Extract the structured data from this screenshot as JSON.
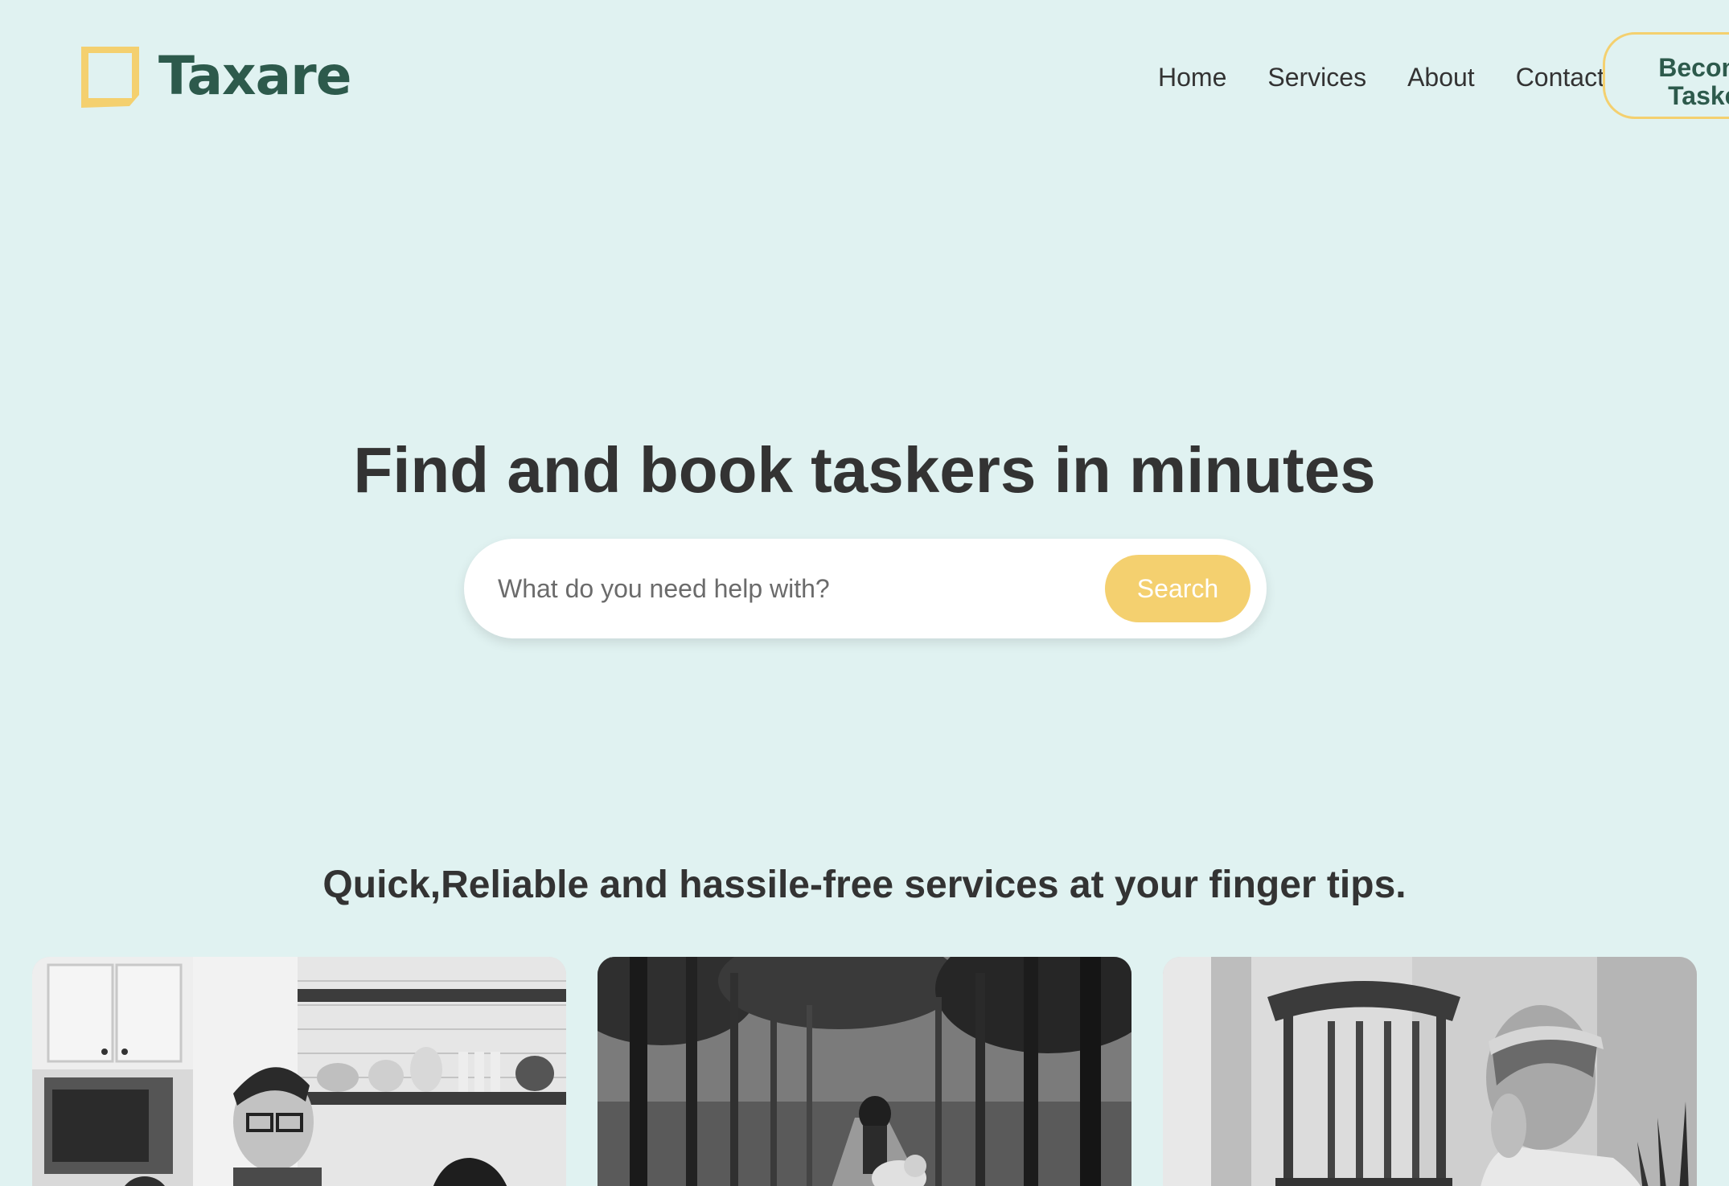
{
  "brand": {
    "name": "Taxare",
    "logo_icon": "square-frame-icon",
    "color_primary": "#2d5a4c",
    "color_accent": "#f4d06f",
    "color_background": "#e0f2f1"
  },
  "nav": {
    "items": [
      {
        "label": "Home"
      },
      {
        "label": "Services"
      },
      {
        "label": "About"
      },
      {
        "label": "Contact"
      }
    ],
    "cta": {
      "line1": "Become",
      "line2": "Tasker"
    }
  },
  "hero": {
    "title": "Find and book taskers in minutes",
    "search": {
      "placeholder": "What do you need help with?",
      "value": "",
      "button_label": "Search"
    }
  },
  "services": {
    "tagline": "Quick,Reliable and hassile-free services at your finger tips.",
    "cards": [
      {
        "image": "kitchen-photo"
      },
      {
        "image": "park-trees-photo"
      },
      {
        "image": "woman-chair-photo"
      }
    ]
  }
}
